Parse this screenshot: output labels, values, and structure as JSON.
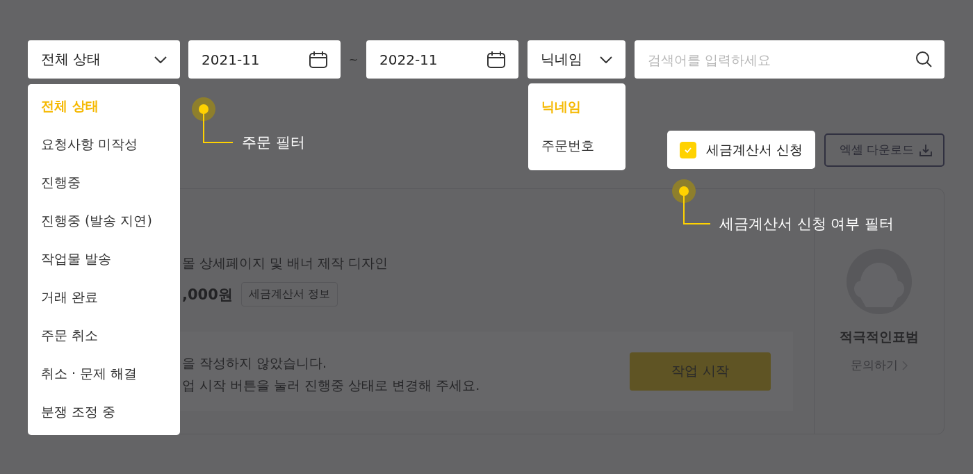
{
  "filters": {
    "status_select": {
      "value": "전체 상태"
    },
    "date_from": {
      "value": "2021-11"
    },
    "separator": "~",
    "date_to": {
      "value": "2022-11"
    },
    "search_type_select": {
      "value": "닉네임"
    },
    "search": {
      "placeholder": "검색어를 입력하세요"
    }
  },
  "status_menu": {
    "items": [
      {
        "label": "전체 상태",
        "selected": true
      },
      {
        "label": "요청사항 미작성",
        "selected": false
      },
      {
        "label": "진행중",
        "selected": false
      },
      {
        "label": "진행중 (발송 지연)",
        "selected": false
      },
      {
        "label": "작업물 발송",
        "selected": false
      },
      {
        "label": "거래 완료",
        "selected": false
      },
      {
        "label": "주문 취소",
        "selected": false
      },
      {
        "label": "취소 · 문제 해결",
        "selected": false
      },
      {
        "label": "분쟁 조정 중",
        "selected": false
      }
    ]
  },
  "search_type_menu": {
    "items": [
      {
        "label": "닉네임",
        "selected": true
      },
      {
        "label": "주문번호",
        "selected": false
      }
    ]
  },
  "tax_invoice_checkbox": {
    "label": "세금계산서 신청",
    "checked": true
  },
  "excel_button": {
    "label": "엑셀 다운로드"
  },
  "callouts": [
    {
      "text": "주문 필터"
    },
    {
      "text": "세금계산서 신청 여부 필터"
    }
  ],
  "order_card": {
    "title": "몰 상세페이지 및 배너 제작 디자인",
    "price": ",000원",
    "tax_info_button": "세금계산서 정보",
    "notice_lines": [
      "을 작성하지 않았습니다.",
      "업 시작 버튼을 눌러 진행중 상태로 변경해 주세요."
    ],
    "start_button": "작업 시작",
    "seller": {
      "name": "적극적인표범",
      "contact_link": "문의하기"
    }
  }
}
